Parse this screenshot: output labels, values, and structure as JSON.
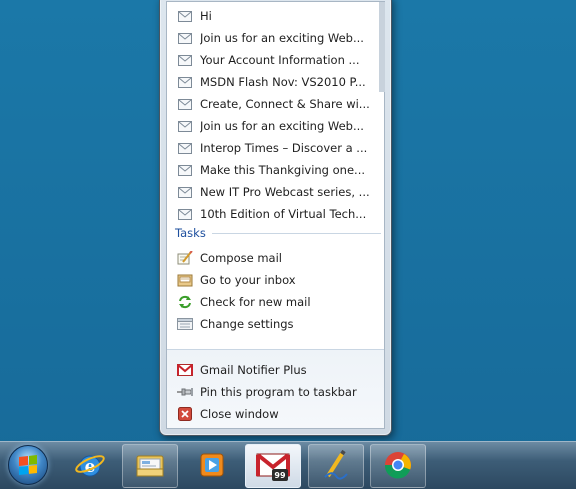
{
  "emails": [
    {
      "label": "Hi",
      "icon": "envelope-icon"
    },
    {
      "label": "Join us for an exciting Web...",
      "icon": "envelope-icon"
    },
    {
      "label": "Your Account Information ...",
      "icon": "envelope-icon"
    },
    {
      "label": "MSDN Flash Nov: VS2010 P...",
      "icon": "envelope-icon"
    },
    {
      "label": "Create, Connect & Share wi...",
      "icon": "envelope-icon"
    },
    {
      "label": "Join us for an exciting Web...",
      "icon": "envelope-icon"
    },
    {
      "label": "Interop Times – Discover a ...",
      "icon": "envelope-icon"
    },
    {
      "label": "Make this Thankgiving one...",
      "icon": "envelope-icon"
    },
    {
      "label": "New IT Pro Webcast series, ...",
      "icon": "envelope-icon"
    },
    {
      "label": "10th Edition of Virtual Tech...",
      "icon": "envelope-icon"
    }
  ],
  "tasks": {
    "header": "Tasks",
    "items": [
      {
        "label": "Compose mail",
        "icon": "compose-icon"
      },
      {
        "label": "Go to your inbox",
        "icon": "inbox-icon"
      },
      {
        "label": "Check for new mail",
        "icon": "refresh-icon"
      },
      {
        "label": "Change settings",
        "icon": "settings-icon"
      }
    ]
  },
  "program": {
    "app_name": "Gmail Notifier Plus",
    "pin_label": "Pin this program to taskbar",
    "close_label": "Close window"
  },
  "taskbar": {
    "items": [
      {
        "name": "start-button",
        "icon": "windows-logo-icon"
      },
      {
        "name": "internet-explorer",
        "icon": "ie-icon"
      },
      {
        "name": "windows-explorer",
        "icon": "folder-icon"
      },
      {
        "name": "media-player",
        "icon": "media-player-icon"
      },
      {
        "name": "gmail-notifier",
        "icon": "gmail-icon",
        "badge": "99"
      },
      {
        "name": "writer",
        "icon": "pen-icon"
      },
      {
        "name": "chrome",
        "icon": "chrome-icon"
      }
    ]
  },
  "colors": {
    "desktop": "#1a6d9c",
    "tasks_header": "#1e4f9e",
    "gmail_red": "#c8232c"
  }
}
